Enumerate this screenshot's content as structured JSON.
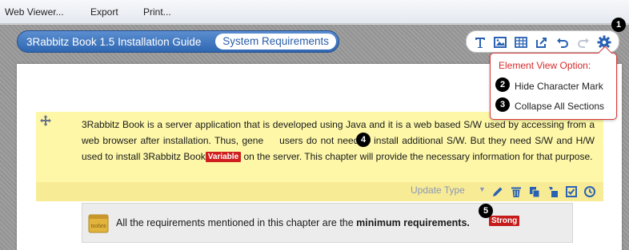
{
  "menubar": {
    "items": [
      {
        "label": "Web Viewer..."
      },
      {
        "label": "Export"
      },
      {
        "label": "Print..."
      }
    ]
  },
  "breadcrumb": {
    "book": "3Rabbitz Book 1.5 Installation Guide",
    "current": "System Requirements"
  },
  "toolbar": {
    "icons": [
      "text-icon",
      "image-icon",
      "table-icon",
      "export-icon",
      "undo-icon",
      "redo-icon",
      "gear-icon"
    ],
    "accent": "#2a62b3"
  },
  "popup": {
    "title": "Element View Option:",
    "items": [
      {
        "label": "Hide Character Mark"
      },
      {
        "label": "Collapse All Sections"
      }
    ],
    "border_color": "#d73a3a"
  },
  "paragraph": {
    "text_before": "3Rabbitz Book is a server application that is developed using Java and it is a web based S/W used by accessing from a web browser after installation. Thus, gene",
    "text_after_marker": "users do not need to install additional S/W. But they need S/W and H/W used to install 3Rabbitz Book",
    "tag": "Variable",
    "text_end": " on the server. This chapter will provide the necessary information for that purpose.",
    "background": "#fdf7a7"
  },
  "paragraph_toolbar": {
    "update_type_label": "Update Type",
    "icons": [
      "edit-icon",
      "delete-icon",
      "copy-icon",
      "paste-icon",
      "check-icon",
      "history-icon"
    ]
  },
  "note": {
    "icon_label": "notes",
    "text_normal": "All the requirements mentioned in this chapter are the ",
    "text_bold": "minimum requirements.",
    "tag": "Strong"
  },
  "markers": [
    "1",
    "2",
    "3",
    "4",
    "5"
  ]
}
